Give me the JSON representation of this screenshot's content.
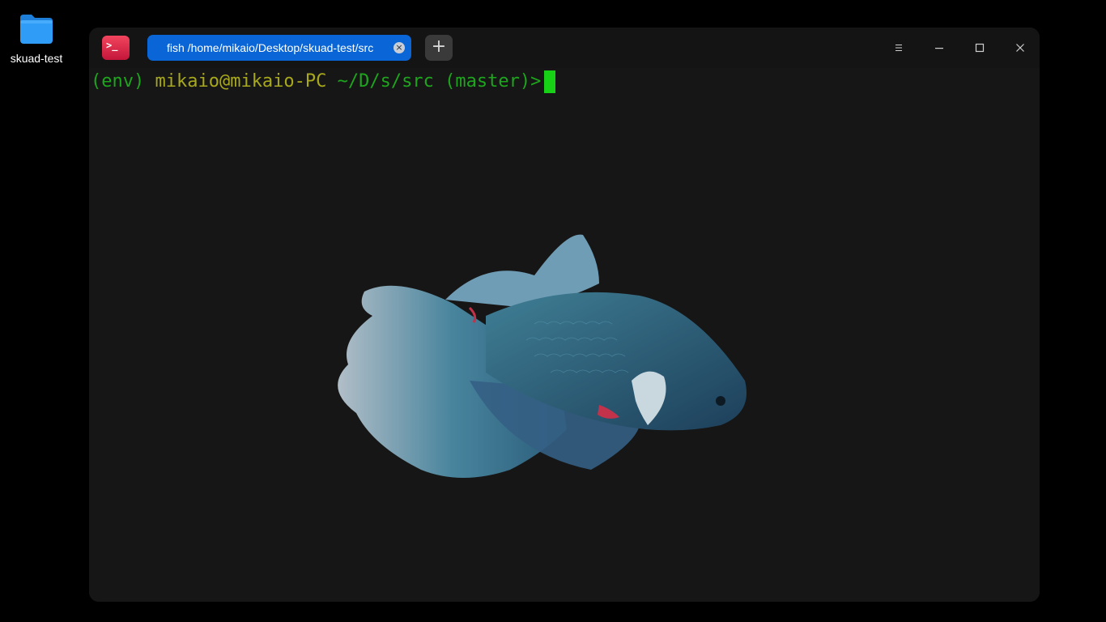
{
  "desktop": {
    "icons": [
      {
        "label": "skuad-test",
        "icon": "folder-icon",
        "color": "#2f9df7"
      }
    ]
  },
  "window": {
    "app_icon_glyph": ">_",
    "tabs": [
      {
        "title": "fish /home/mikaio/Desktop/skuad-test/src",
        "active": true,
        "close_glyph": "×"
      }
    ],
    "new_tab_glyph": "+",
    "controls": [
      "menu-icon",
      "minimize-icon",
      "maximize-icon",
      "close-icon"
    ]
  },
  "terminal": {
    "prompt": {
      "env": "(env)",
      "user_host": "mikaio@mikaio-PC",
      "path": "~/D/s/src",
      "branch": "(master)>"
    },
    "background_image": "betta-fish",
    "colors": {
      "background": "#161616",
      "prompt_green": "#1ea51e",
      "prompt_yellow": "#a8a81c",
      "cursor": "#17d117",
      "tab_active": "#0a66d6"
    }
  }
}
